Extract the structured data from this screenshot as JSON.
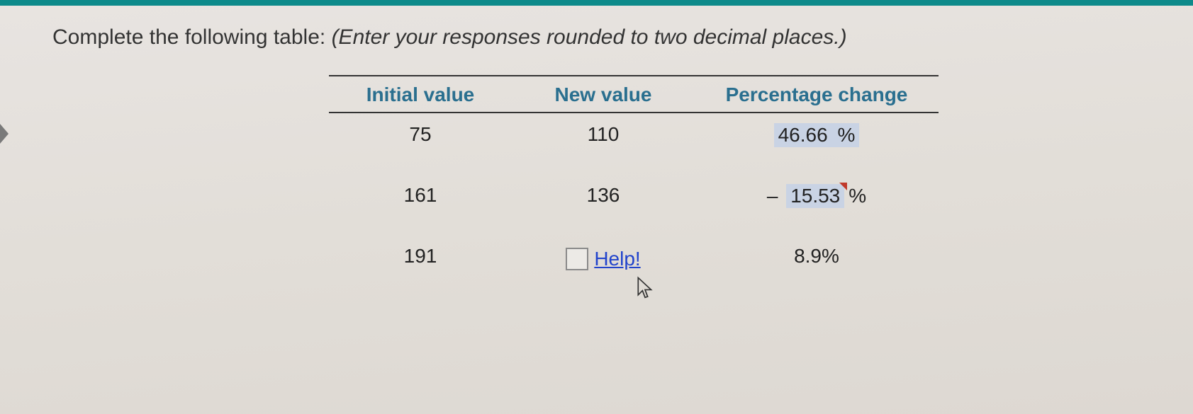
{
  "instruction": {
    "prefix": "Complete the following table:  ",
    "italic": "(Enter your responses rounded to two decimal places.)"
  },
  "headers": {
    "col1": "Initial value",
    "col2": "New value",
    "col3": "Percentage change"
  },
  "rows": [
    {
      "initial": "75",
      "newval": "110",
      "pct": "46.66",
      "pct_symbol": "%",
      "minus": ""
    },
    {
      "initial": "161",
      "newval": "136",
      "pct": "15.53",
      "pct_symbol": "%",
      "minus": "– "
    },
    {
      "initial": "191",
      "newval": "",
      "pct": "8.9%",
      "pct_symbol": "",
      "minus": ""
    }
  ],
  "help_label": "Help!",
  "chart_data": {
    "type": "table",
    "title": "Percentage change table",
    "columns": [
      "Initial value",
      "New value",
      "Percentage change"
    ],
    "rows": [
      {
        "Initial value": 75,
        "New value": 110,
        "Percentage change": 46.66
      },
      {
        "Initial value": 161,
        "New value": 136,
        "Percentage change": -15.53
      },
      {
        "Initial value": 191,
        "New value": null,
        "Percentage change": 8.9
      }
    ]
  }
}
